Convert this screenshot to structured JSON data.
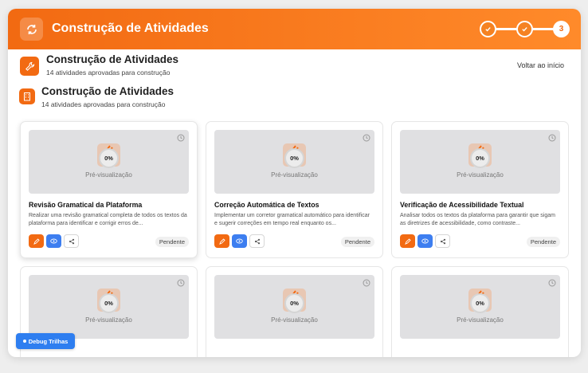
{
  "header": {
    "title": "Construção de Atividades",
    "icon": "refresh-icon",
    "steps": [
      {
        "state": "done",
        "label": ""
      },
      {
        "state": "done",
        "label": ""
      },
      {
        "state": "current",
        "label": "3"
      }
    ]
  },
  "section1": {
    "title": "Construção de Atividades",
    "subtitle": "14 atividades aprovadas para construção",
    "icon": "wrench-icon"
  },
  "section2": {
    "title": "Construção de Atividades",
    "subtitle": "14 atividades aprovadas para construção",
    "icon": "building-icon"
  },
  "back_link": "Voltar ao início",
  "cards": [
    {
      "preview_percent": "0%",
      "preview_label": "Pré-visualização",
      "title": "Revisão Gramatical da Plataforma",
      "description": "Realizar uma revisão gramatical completa de todos os textos da plataforma para identificar e corrigir erros de...",
      "status": "Pendente"
    },
    {
      "preview_percent": "0%",
      "preview_label": "Pré-visualização",
      "title": "Correção Automática de Textos",
      "description": "Implementar um corretor gramatical automático para identificar e sugerir correções em tempo real enquanto os...",
      "status": "Pendente"
    },
    {
      "preview_percent": "0%",
      "preview_label": "Pré-visualização",
      "title": "Verificação de Acessibilidade Textual",
      "description": "Analisar todos os textos da plataforma para garantir que sigam as diretrizes de acessibilidade, como contraste...",
      "status": "Pendente"
    },
    {
      "preview_percent": "0%",
      "preview_label": "Pré-visualização"
    },
    {
      "preview_percent": "0%",
      "preview_label": "Pré-visualização"
    },
    {
      "preview_percent": "0%",
      "preview_label": "Pré-visualização"
    }
  ],
  "debug_button": "Debug Trilhas",
  "colors": {
    "accent": "#f26a12",
    "view_button": "#3d7ef0",
    "debug_button": "#2e7ef0"
  }
}
